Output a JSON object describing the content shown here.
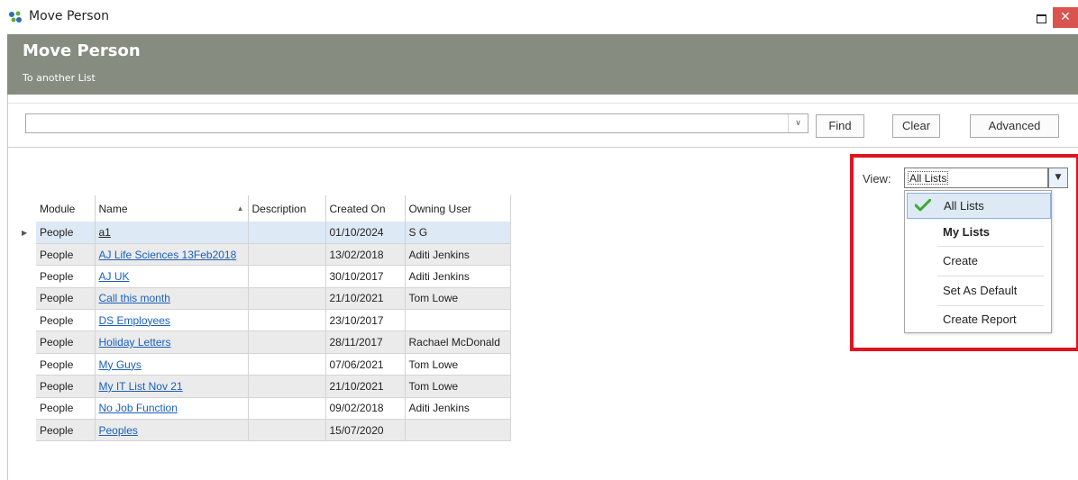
{
  "window": {
    "title": "Move Person",
    "close_glyph": "✕"
  },
  "header": {
    "title": "Move Person",
    "subtitle": "To another List"
  },
  "search": {
    "value": "",
    "dropdown_glyph": "∨",
    "find_label": "Find",
    "clear_label": "Clear",
    "advanced_label": "Advanced"
  },
  "view": {
    "label": "View:",
    "selected": "All Lists",
    "dropdown_glyph": "▼",
    "options": [
      {
        "label": "All Lists",
        "checked": true
      },
      {
        "label": "My Lists",
        "bold": true
      },
      {
        "label": "Create"
      },
      {
        "label": "Set As Default"
      },
      {
        "label": "Create Report"
      }
    ]
  },
  "table": {
    "columns": [
      "Module",
      "Name",
      "Description",
      "Created On",
      "Owning User"
    ],
    "sort_glyph": "▲",
    "row_indicator_glyph": "▶",
    "rows": [
      {
        "module": "People",
        "name": "a1",
        "description": "",
        "created_on": "01/10/2024",
        "owner": "S G"
      },
      {
        "module": "People",
        "name": "AJ Life Sciences 13Feb2018",
        "description": "",
        "created_on": "13/02/2018",
        "owner": "Aditi Jenkins"
      },
      {
        "module": "People",
        "name": "AJ UK",
        "description": "",
        "created_on": "30/10/2017",
        "owner": "Aditi Jenkins"
      },
      {
        "module": "People",
        "name": "Call this month",
        "description": "",
        "created_on": "21/10/2021",
        "owner": "Tom Lowe"
      },
      {
        "module": "People",
        "name": "DS Employees",
        "description": "",
        "created_on": "23/10/2017",
        "owner": ""
      },
      {
        "module": "People",
        "name": "Holiday Letters",
        "description": "",
        "created_on": "28/11/2017",
        "owner": "Rachael McDonald"
      },
      {
        "module": "People",
        "name": "My Guys",
        "description": "",
        "created_on": "07/06/2021",
        "owner": "Tom Lowe"
      },
      {
        "module": "People",
        "name": "My IT List Nov 21",
        "description": "",
        "created_on": "21/10/2021",
        "owner": "Tom Lowe"
      },
      {
        "module": "People",
        "name": "No Job Function",
        "description": "",
        "created_on": "09/02/2018",
        "owner": "Aditi Jenkins"
      },
      {
        "module": "People",
        "name": "Peoples",
        "description": "",
        "created_on": "15/07/2020",
        "owner": ""
      }
    ]
  },
  "colors": {
    "header_bg": "#868c80",
    "highlight": "#e0141e",
    "link": "#1b5fbb",
    "check": "#3aa935"
  }
}
